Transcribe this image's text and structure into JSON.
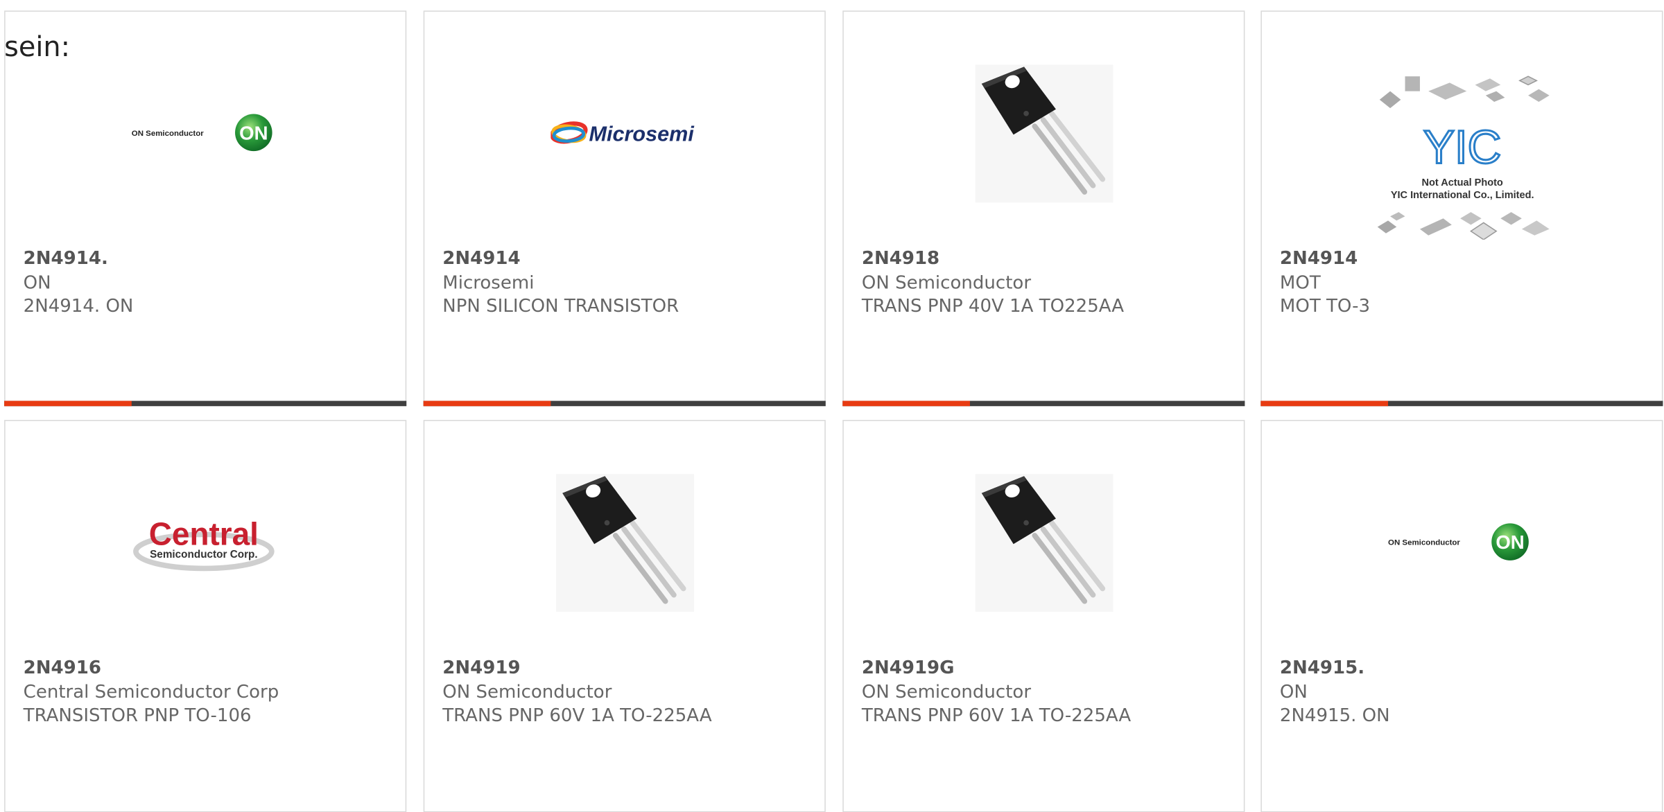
{
  "intro_text": "sein:",
  "colors": {
    "accent": "#e83b12",
    "bar": "#3f3f3f",
    "border": "#d9d9d9",
    "text": "#666666"
  },
  "logos": {
    "on_small": "ON Semiconductor",
    "on_badge": "ON",
    "microsemi": "Microsemi",
    "central_big": "Central",
    "central_small": "Semiconductor Corp.",
    "yic_mark": "YIC",
    "yic_line1": "Not Actual Photo",
    "yic_line2": "YIC International Co., Limited."
  },
  "products": [
    {
      "part": "2N4914.",
      "maker": "ON",
      "desc": "2N4914. ON",
      "image": "on-semiconductor-logo"
    },
    {
      "part": "2N4914",
      "maker": "Microsemi",
      "desc": "NPN SILICON TRANSISTOR",
      "image": "microsemi-logo"
    },
    {
      "part": "2N4918",
      "maker": "ON Semiconductor",
      "desc": "TRANS PNP 40V 1A TO225AA",
      "image": "to225-transistor-photo"
    },
    {
      "part": "2N4914",
      "maker": "MOT",
      "desc": "MOT TO-3",
      "image": "yic-placeholder"
    },
    {
      "part": "2N4916",
      "maker": "Central Semiconductor Corp",
      "desc": "TRANSISTOR PNP TO-106",
      "image": "central-semiconductor-logo"
    },
    {
      "part": "2N4919",
      "maker": "ON Semiconductor",
      "desc": "TRANS PNP 60V 1A TO-225AA",
      "image": "to225-transistor-photo"
    },
    {
      "part": "2N4919G",
      "maker": "ON Semiconductor",
      "desc": "TRANS PNP 60V 1A TO-225AA",
      "image": "to225-transistor-photo"
    },
    {
      "part": "2N4915.",
      "maker": "ON",
      "desc": "2N4915. ON",
      "image": "on-semiconductor-logo"
    }
  ]
}
